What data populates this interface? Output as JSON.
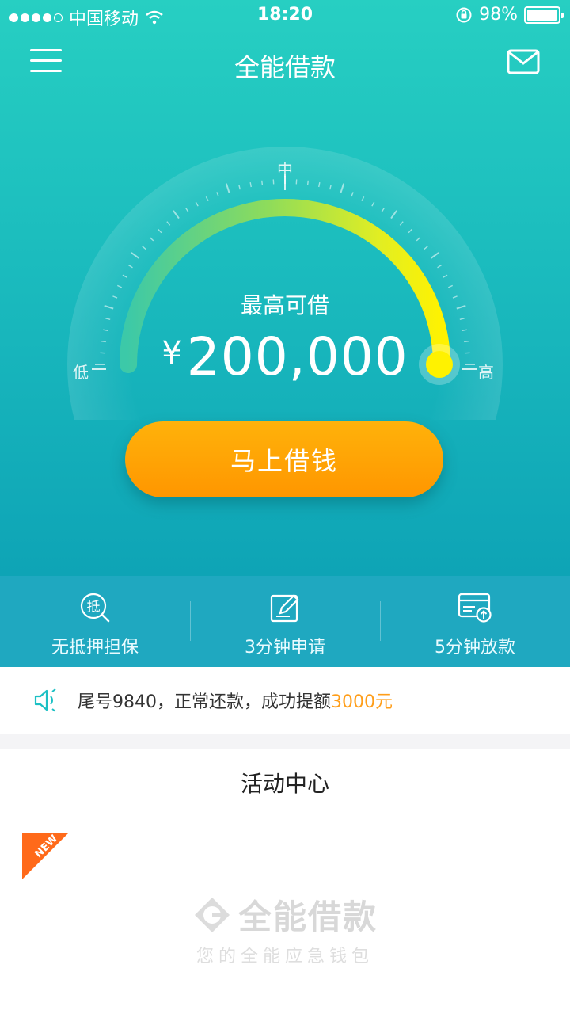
{
  "status_bar": {
    "carrier": "中国移动",
    "time": "18:20",
    "battery_percent": "98%",
    "battery_level": 0.98
  },
  "nav": {
    "title": "全能借款",
    "menu_icon": "menu-icon",
    "mail_icon": "mail-icon"
  },
  "gauge": {
    "label_low": "低",
    "label_mid": "中",
    "label_high": "高",
    "caption": "最高可借",
    "currency": "¥",
    "amount": "200,000",
    "level": 1.0
  },
  "cta": {
    "label": "马上借钱"
  },
  "features": [
    {
      "label": "无抵押担保",
      "icon": "no-collateral-icon",
      "icon_char": "抵"
    },
    {
      "label": "3分钟申请",
      "icon": "edit-form-icon"
    },
    {
      "label": "5分钟放款",
      "icon": "fast-payout-icon"
    }
  ],
  "notice": {
    "text": "尾号9840，正常还款，成功提额",
    "amount": "3000元",
    "icon": "speaker-icon"
  },
  "activity": {
    "title": "活动中心",
    "badge": "NEW",
    "promo_name": "全能借款",
    "promo_slogan": "您的全能应急钱包"
  },
  "colors": {
    "hero_top": "#27cfc2",
    "hero_bottom": "#0ea4b6",
    "cta": "#ff9f00",
    "highlight": "#ff9e1a",
    "badge": "#ff6a1a"
  }
}
